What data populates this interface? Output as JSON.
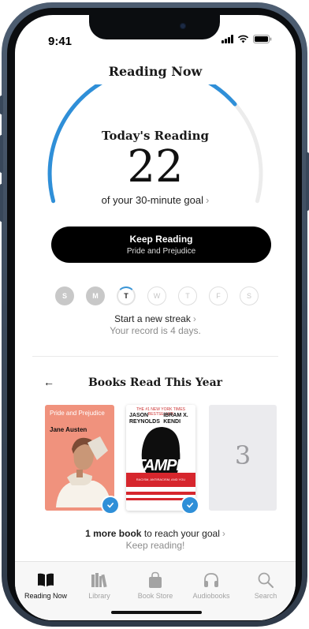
{
  "status": {
    "time": "9:41"
  },
  "header": {
    "title": "Reading Now"
  },
  "reading": {
    "label": "Today's Reading",
    "minutes": "22",
    "goal_text": "of your 30-minute goal",
    "progress": 0.733
  },
  "keep_reading": {
    "label": "Keep Reading",
    "book": "Pride and Prejudice"
  },
  "week": [
    {
      "letter": "S",
      "state": "done"
    },
    {
      "letter": "M",
      "state": "done"
    },
    {
      "letter": "T",
      "state": "today"
    },
    {
      "letter": "W",
      "state": "future"
    },
    {
      "letter": "T",
      "state": "future"
    },
    {
      "letter": "F",
      "state": "future"
    },
    {
      "letter": "S",
      "state": "future"
    }
  ],
  "streak": {
    "title": "Start a new streak",
    "record": "Your record is 4 days."
  },
  "books_section": {
    "title": "Books Read This Year",
    "book1": {
      "title": "Pride and Prejudice",
      "author": "Jane Austen"
    },
    "book2": {
      "header": "THE #1 NEW YORK TIMES BESTSELLER",
      "author1": "JASON REYNOLDS",
      "author2": "IBRAM X. KENDI",
      "title": "STAMPED",
      "subtitle": "RACISM, ANTIRACISM, AND YOU"
    },
    "placeholder_number": "3",
    "goal_bold": "1 more book",
    "goal_rest": "to reach your goal",
    "encourage": "Keep reading!"
  },
  "tabs": [
    {
      "label": "Reading Now",
      "icon": "book-open-icon",
      "active": true
    },
    {
      "label": "Library",
      "icon": "library-icon",
      "active": false
    },
    {
      "label": "Book Store",
      "icon": "shopping-bag-icon",
      "active": false
    },
    {
      "label": "Audiobooks",
      "icon": "headphones-icon",
      "active": false
    },
    {
      "label": "Search",
      "icon": "search-icon",
      "active": false
    }
  ],
  "colors": {
    "accent": "#2f8fd8",
    "button": "#000000",
    "gauge_track": "#ececec",
    "cover_pink": "#f0927d"
  }
}
